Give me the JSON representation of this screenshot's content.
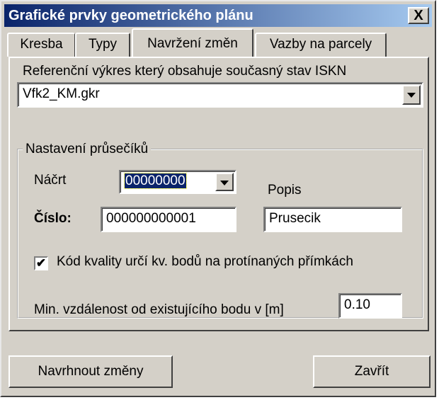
{
  "window": {
    "title": "Grafické prvky geometrického plánu",
    "close_symbol": "X"
  },
  "tabs": [
    {
      "label": "Kresba"
    },
    {
      "label": "Typy"
    },
    {
      "label": "Navržení změn",
      "active": true
    },
    {
      "label": "Vazby na parcely"
    }
  ],
  "reference": {
    "label": "Referenční výkres který obsahuje současný stav ISKN",
    "value": "Vfk2_KM.gkr"
  },
  "group": {
    "title": "Nastavení průsečíků",
    "nacrt_label": "Náčrt",
    "nacrt_value": "00000000",
    "popis_label": "Popis",
    "popis_value": "Prusecik",
    "cislo_label": "Číslo:",
    "cislo_value": "000000000001",
    "quality_checkbox_label": "Kód kvality určí kv. bodů na protínaných přímkách",
    "quality_checked": true,
    "check_mark": "✔",
    "min_distance_label": "Min. vzdálenost od existujícího bodu v [m]",
    "min_distance_value": "0.10"
  },
  "buttons": {
    "propose": "Navrhnout změny",
    "close": "Zavřít"
  }
}
